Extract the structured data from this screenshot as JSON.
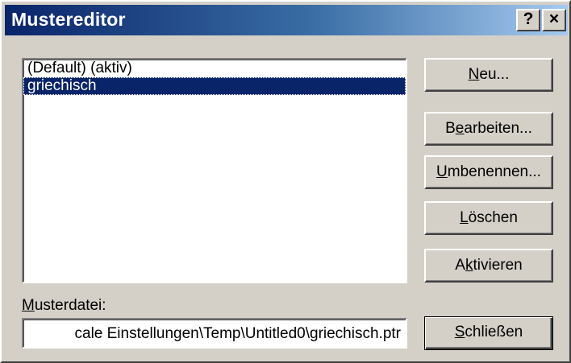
{
  "window": {
    "title": "Mustereditor",
    "help_label": "?",
    "close_label": "×"
  },
  "list": {
    "items": [
      {
        "label": "(Default) (aktiv)",
        "selected": false
      },
      {
        "label": "griechisch",
        "selected": true
      }
    ]
  },
  "file": {
    "label_mnemonic": "M",
    "label_rest": "usterdatei:",
    "path_visible": "cale Einstellungen\\Temp\\Untitled0\\griechisch.ptr"
  },
  "buttons": {
    "neu": {
      "mn": "N",
      "rest": "eu..."
    },
    "bearbeiten": {
      "pre": "B",
      "mn": "e",
      "rest": "arbeiten..."
    },
    "umbenennen": {
      "mn": "U",
      "rest": "mbenennen..."
    },
    "loeschen": {
      "mn": "L",
      "rest": "öschen"
    },
    "aktivieren": {
      "pre": "A",
      "mn": "k",
      "rest": "tivieren"
    },
    "schliessen": {
      "mn": "S",
      "rest": "chließen"
    }
  },
  "colors": {
    "title_gradient_start": "#0a246a",
    "title_gradient_end": "#a6caf0",
    "selection": "#0a246a",
    "face": "#d4d0c8"
  }
}
